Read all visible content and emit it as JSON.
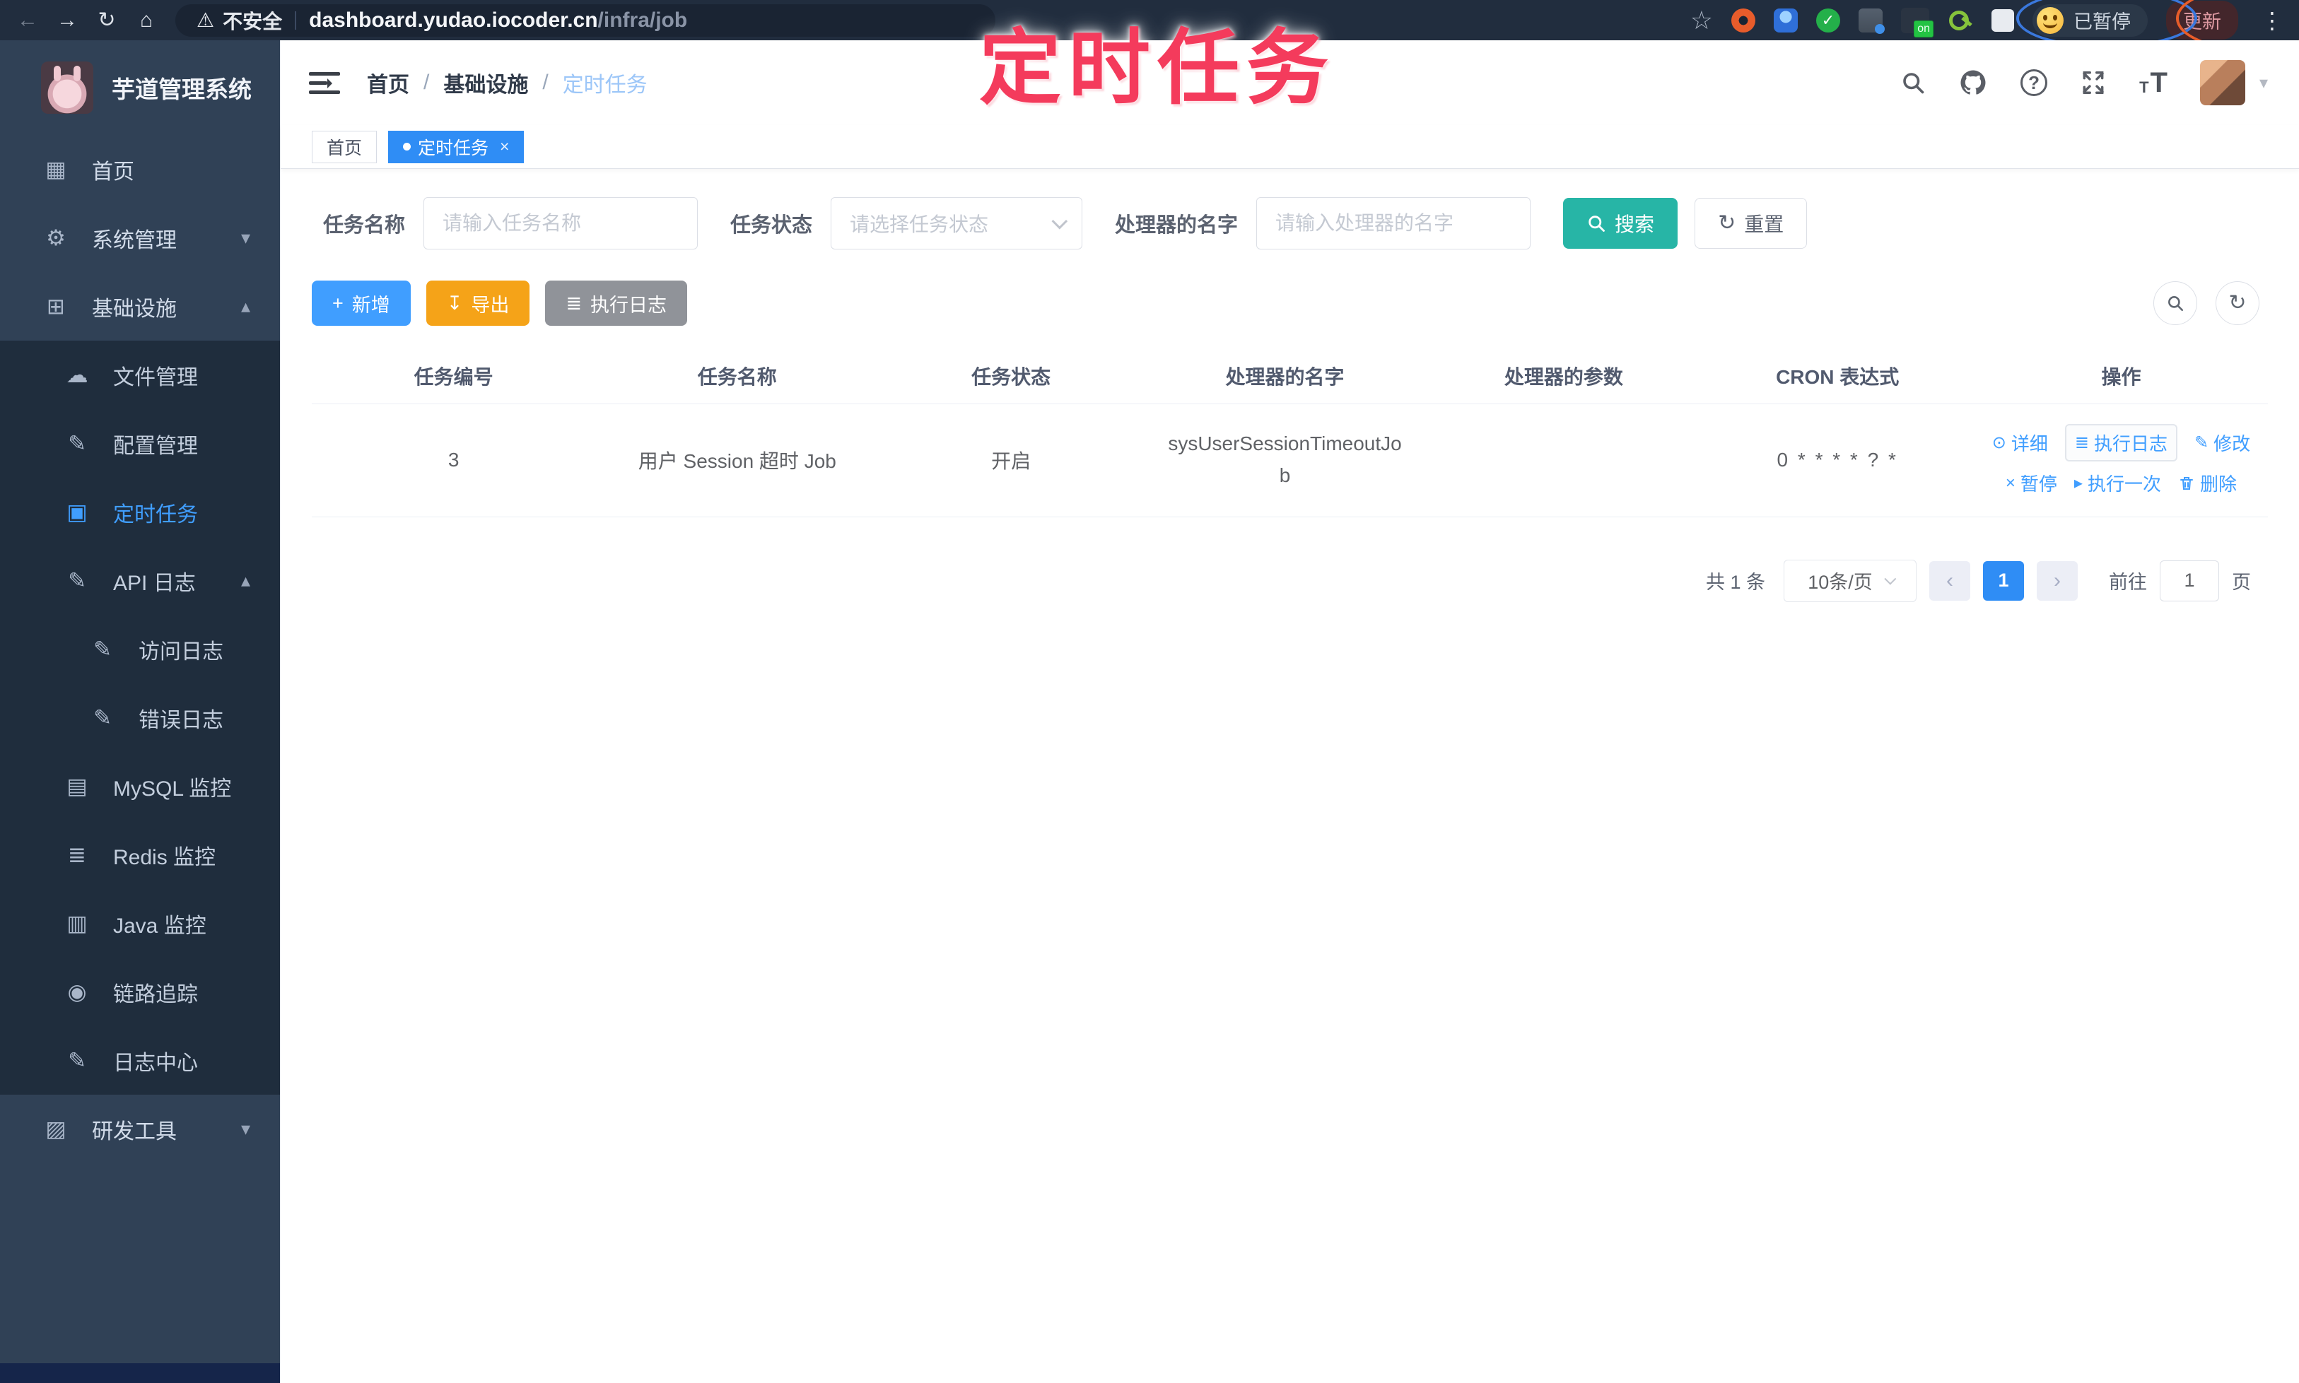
{
  "browser": {
    "insecure_label": "不安全",
    "url_host": "dashboard.yudao.iocoder.cn",
    "url_path": "/infra/job",
    "paused_label": "已暂停",
    "update_label": "更新",
    "extension_badge": "on"
  },
  "overlay": {
    "title": "定时任务",
    "color": "#f43b5c"
  },
  "icons": {
    "back": "←",
    "forward": "→",
    "reload": "↻",
    "home": "⌂",
    "warning": "⚠",
    "star": "☆",
    "menu_dots": "⋮",
    "caret_down": "▾",
    "dashboard": "▦",
    "gear": "⚙",
    "infra": "⊞",
    "cloud_upload": "☁",
    "edit": "✎",
    "timer_doc": "▣",
    "server": "▤",
    "layers": "≣",
    "eye": "◉",
    "monitor": "▥",
    "briefcase": "▨",
    "chevron_down": "▾",
    "chevron_up": "▴",
    "plus": "+",
    "download": "↧",
    "list": "≣",
    "refresh": "↻",
    "op_view": "⊙",
    "op_log": "≣",
    "op_edit": "✎",
    "op_pause": "×",
    "op_run": "▸",
    "close": "×",
    "question": "?",
    "prev": "‹",
    "next": "›"
  },
  "sidebar": {
    "app_title": "芋道管理系统",
    "items": [
      {
        "label": "首页"
      },
      {
        "label": "系统管理"
      },
      {
        "label": "基础设施"
      },
      {
        "label": "文件管理"
      },
      {
        "label": "配置管理"
      },
      {
        "label": "定时任务",
        "active": true
      },
      {
        "label": "API 日志"
      },
      {
        "label": "访问日志"
      },
      {
        "label": "错误日志"
      },
      {
        "label": "MySQL 监控"
      },
      {
        "label": "Redis 监控"
      },
      {
        "label": "Java 监控"
      },
      {
        "label": "链路追踪"
      },
      {
        "label": "日志中心"
      },
      {
        "label": "研发工具"
      }
    ]
  },
  "header": {
    "breadcrumb": [
      "首页",
      "基础设施",
      "定时任务"
    ],
    "breadcrumb_sep": "/"
  },
  "tabs": [
    {
      "label": "首页"
    },
    {
      "label": "定时任务"
    }
  ],
  "filters": {
    "name_label": "任务名称",
    "name_placeholder": "请输入任务名称",
    "status_label": "任务状态",
    "status_placeholder": "请选择任务状态",
    "handler_label": "处理器的名字",
    "handler_placeholder": "请输入处理器的名字",
    "search_label": "搜索",
    "reset_label": "重置"
  },
  "toolbar": {
    "add_label": "新增",
    "export_label": "导出",
    "job_log_label": "执行日志"
  },
  "table": {
    "headers": [
      "任务编号",
      "任务名称",
      "任务状态",
      "处理器的名字",
      "处理器的参数",
      "CRON 表达式",
      "操作"
    ],
    "rows": [
      {
        "id": "3",
        "name": "用户 Session 超时 Job",
        "status": "开启",
        "handler": "sysUserSessionTimeoutJob",
        "param": "",
        "cron": "0 * * * * ? *",
        "op_view": "详细",
        "op_log": "执行日志",
        "op_edit": "修改",
        "op_pause": "暂停",
        "op_run": "执行一次",
        "op_delete": "删除"
      }
    ]
  },
  "pagination": {
    "total": "共 1 条",
    "page_size": "10条/页",
    "page": "1",
    "goto_label": "前往",
    "goto_value": "1",
    "page_unit": "页"
  },
  "colors": {
    "accent": "#409eff",
    "teal": "#27b5a6",
    "warning": "#f5a318",
    "info": "#909399",
    "sidebar": "#304156",
    "submenu": "#1f2d3d",
    "overlay_red": "#f43b5c",
    "tab_active": "#2f8df5"
  }
}
